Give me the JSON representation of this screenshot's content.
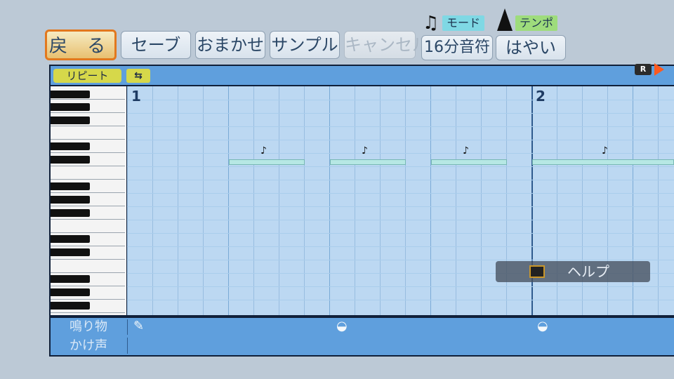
{
  "toolbar": {
    "back_label": "戻 る",
    "save_label": "セーブ",
    "auto_label": "おまかせ",
    "sample_label": "サンプル",
    "cancel_label": "キャンセル",
    "mode_label": "モード",
    "mode_value": "16分音符",
    "tempo_label": "テンポ",
    "tempo_value": "はやい"
  },
  "editor": {
    "repeat_label": "リピート",
    "rec_badge": "R",
    "bars": [
      {
        "number": "1"
      },
      {
        "number": "2"
      }
    ],
    "note_flag": "♪"
  },
  "tracks": [
    {
      "label": "鳴り物"
    },
    {
      "label": "かけ声"
    }
  ],
  "help": {
    "label": "ヘルプ"
  },
  "colors": {
    "grid": "#bcd8f2",
    "accent": "#e2781e",
    "repeat_chip": "#d6d84a",
    "mode_chip": "#7fd8e4",
    "tempo_chip": "#9edc7c"
  }
}
